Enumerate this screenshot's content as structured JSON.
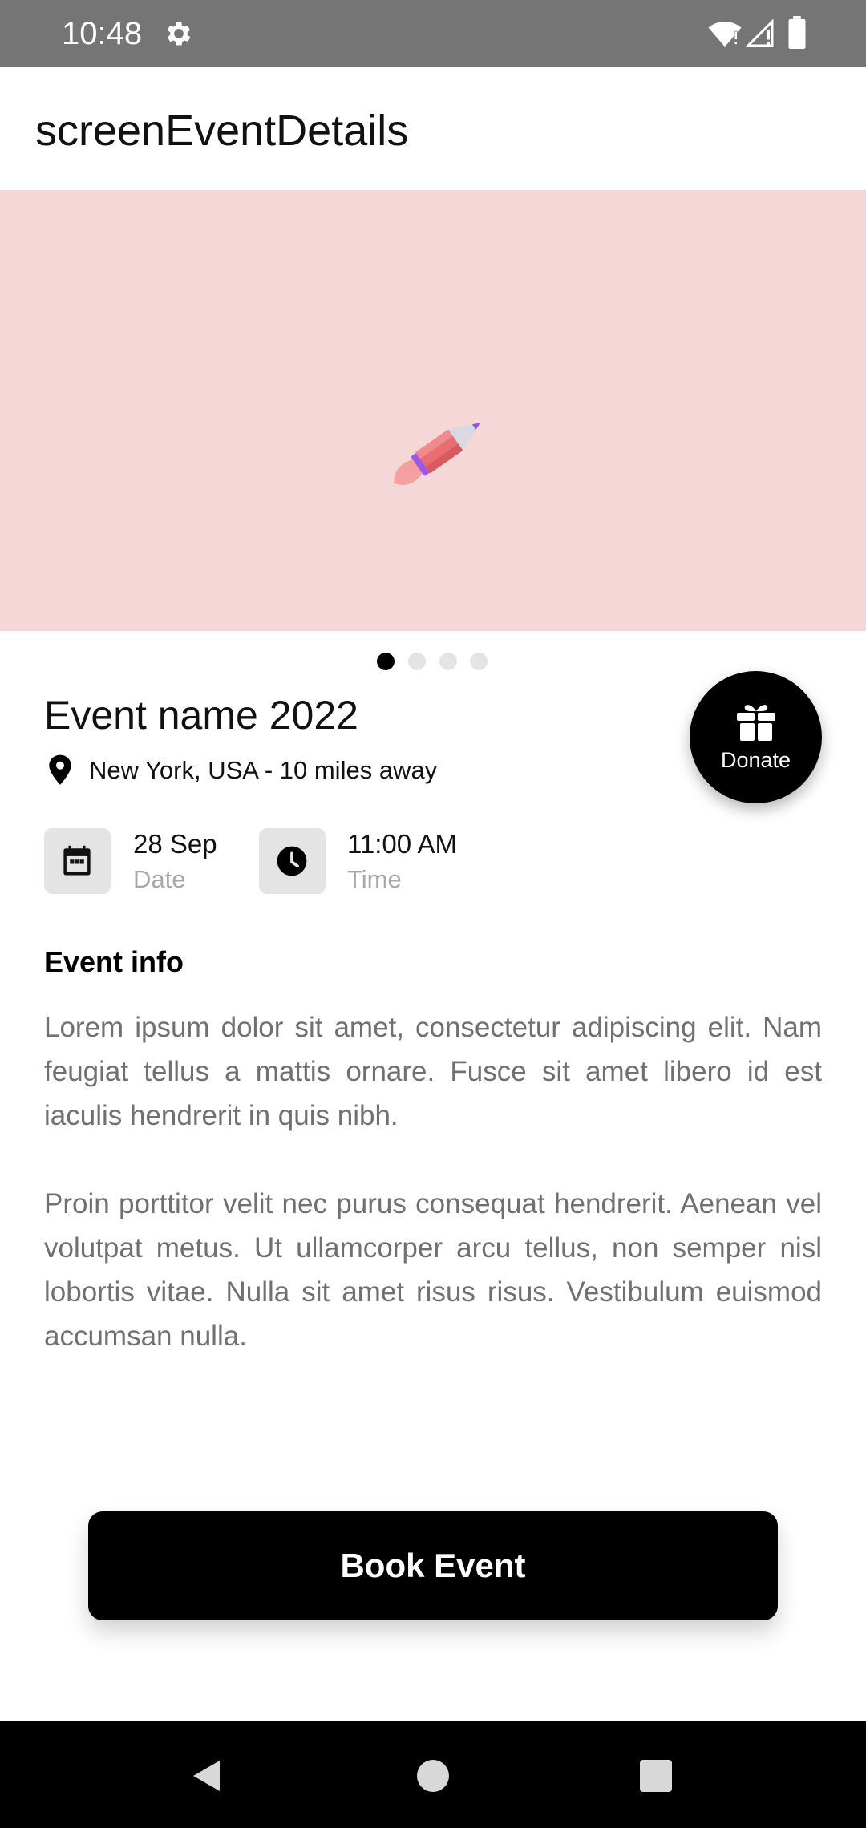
{
  "status_bar": {
    "time": "10:48",
    "icons": [
      "gear-icon",
      "wifi-icon",
      "cell-signal-icon",
      "battery-icon"
    ]
  },
  "app_bar": {
    "title": "screenEventDetails"
  },
  "carousel": {
    "background_color": "#f6d7d8",
    "image_icon": "rocket-icon",
    "page_count": 4,
    "active_page": 1
  },
  "event": {
    "title": "Event name 2022",
    "location": "New York, USA - 10 miles away",
    "date_value": "28 Sep",
    "date_label": "Date",
    "time_value": "11:00 AM",
    "time_label": "Time"
  },
  "donate": {
    "label": "Donate",
    "icon": "gift-icon"
  },
  "event_info": {
    "heading": "Event info",
    "paragraphs": [
      "Lorem ipsum dolor sit amet, consectetur adipiscing elit. Nam feugiat tellus a mattis ornare. Fusce sit amet libero id est iaculis hendrerit in quis nibh.",
      "Proin porttitor velit nec purus consequat hendrerit. Aenean vel volutpat metus. Ut ullamcorper arcu tellus, non semper nisl lobortis vitae. Nulla sit amet risus risus. Vestibulum euismod accumsan nulla."
    ]
  },
  "actions": {
    "book_label": "Book Event"
  },
  "nav_bar": {
    "icons": [
      "back-icon",
      "home-icon",
      "recents-icon"
    ]
  }
}
